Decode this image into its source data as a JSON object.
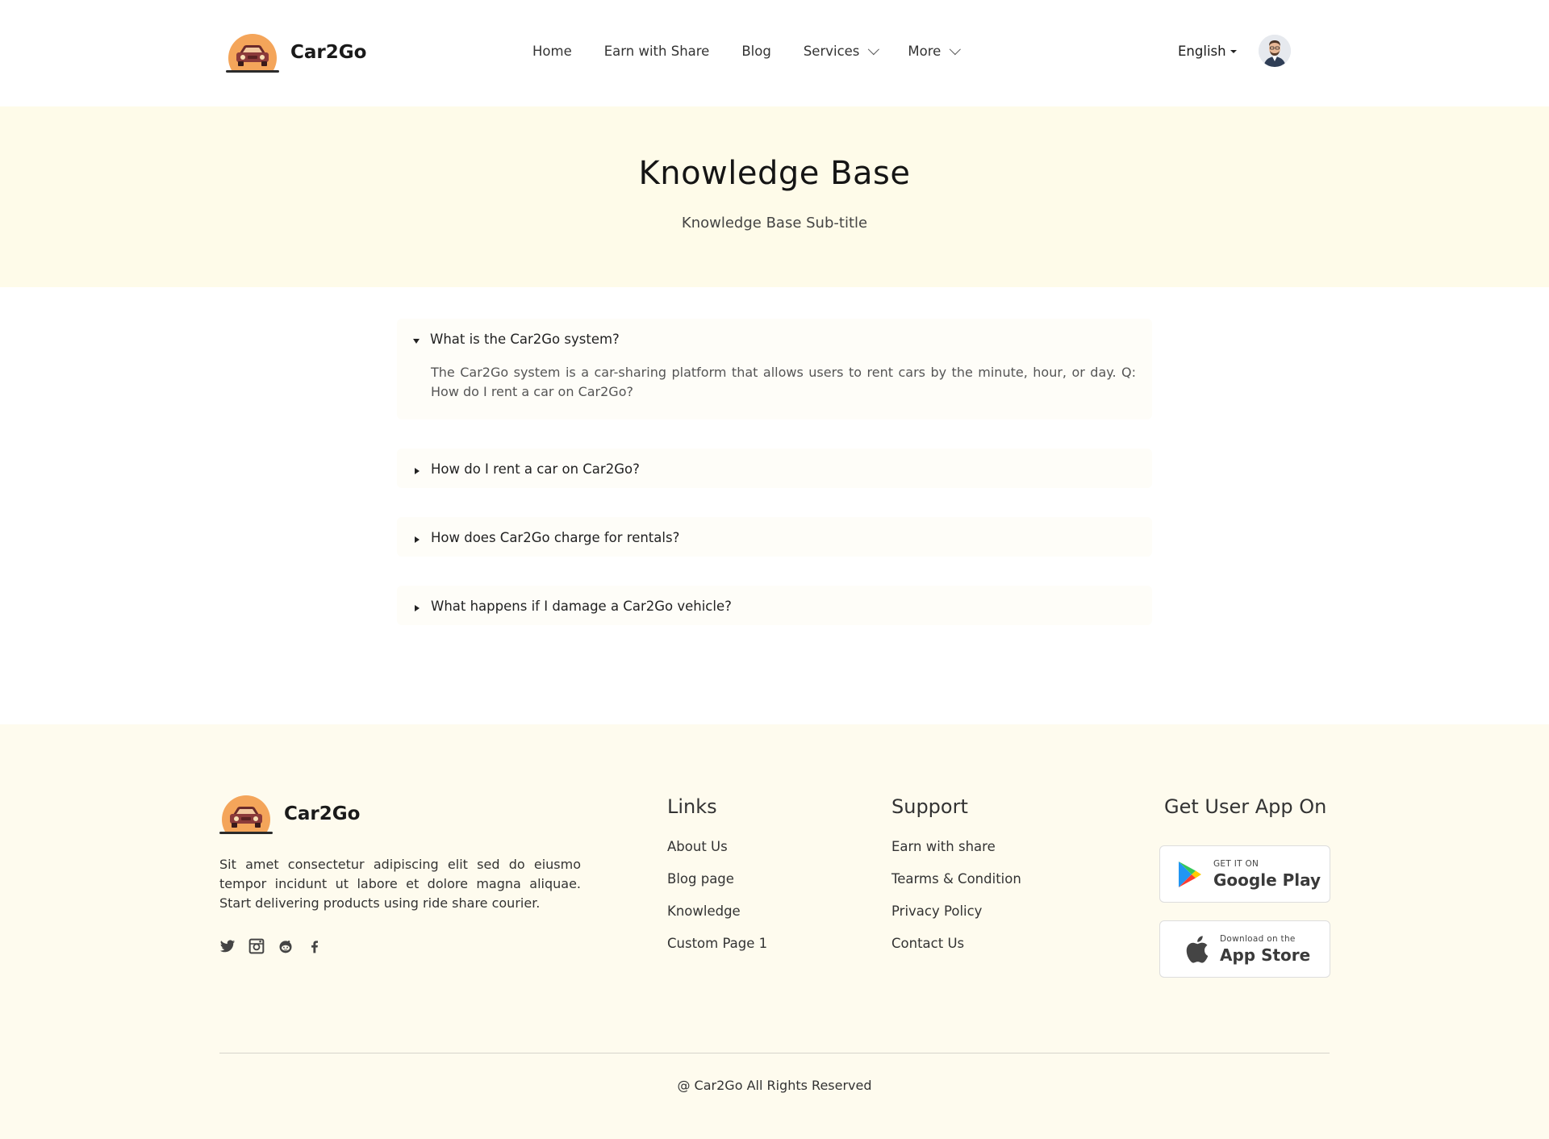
{
  "header": {
    "brand": "Car2Go",
    "nav": [
      {
        "label": "Home",
        "has_dropdown": false
      },
      {
        "label": "Earn with Share",
        "has_dropdown": false
      },
      {
        "label": "Blog",
        "has_dropdown": false
      },
      {
        "label": "Services",
        "has_dropdown": true
      },
      {
        "label": "More",
        "has_dropdown": true
      }
    ],
    "language": "English"
  },
  "hero": {
    "title": "Knowledge Base",
    "subtitle": "Knowledge Base Sub-title"
  },
  "faq": [
    {
      "question": "What is the Car2Go system?",
      "answer": "The Car2Go system is a car-sharing platform that allows users to rent cars by the minute, hour, or day. Q: How do I rent a car on Car2Go?",
      "expanded": true
    },
    {
      "question": "How do I rent a car on Car2Go?",
      "answer": "",
      "expanded": false
    },
    {
      "question": "How does Car2Go charge for rentals?",
      "answer": "",
      "expanded": false
    },
    {
      "question": "What happens if I damage a Car2Go vehicle?",
      "answer": "",
      "expanded": false
    }
  ],
  "footer": {
    "brand": "Car2Go",
    "about": "Sit amet consectetur adipiscing elit sed do eiusmo tempor incidunt ut labore et dolore magna aliquae. Start delivering products using ride share courier.",
    "socials": [
      "twitter-icon",
      "instagram-icon",
      "reddit-icon",
      "facebook-icon"
    ],
    "links": {
      "heading": "Links",
      "items": [
        "About Us",
        "Blog page",
        "Knowledge",
        "Custom Page 1"
      ]
    },
    "support": {
      "heading": "Support",
      "items": [
        "Earn with share",
        "Tearms & Condition",
        "Privacy Policy",
        "Contact Us"
      ]
    },
    "app": {
      "heading": "Get User App On",
      "google_play": {
        "small": "GET IT ON",
        "big": "Google Play"
      },
      "app_store": {
        "small": "Download on the",
        "big": "App Store"
      }
    },
    "copyright": "@ Car2Go All Rights Reserved"
  },
  "colors": {
    "hero_bg": "#fefbe9",
    "footer_bg": "#fefbee",
    "logo_orange": "#f4a55a",
    "car_body": "#8b3a3a"
  }
}
